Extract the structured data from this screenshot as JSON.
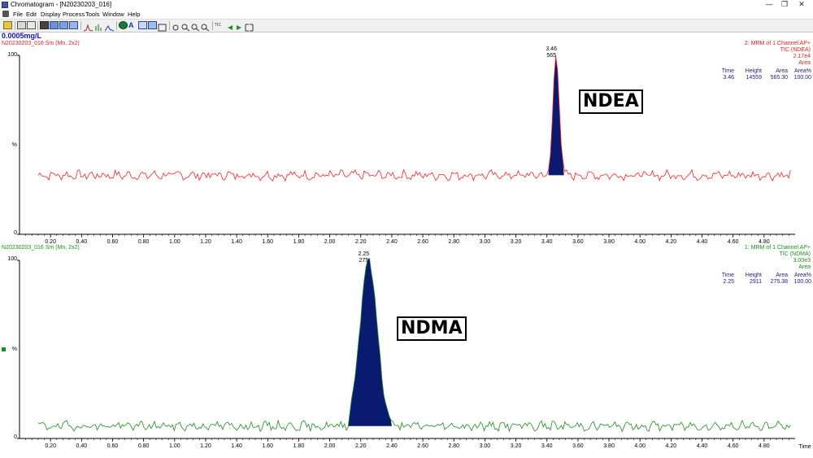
{
  "window": {
    "title": "Chromatogram - [N20230203_016]",
    "minimize_glyph": "—",
    "restore_glyph": "❐",
    "close_glyph": "✕"
  },
  "menu": [
    "File",
    "Edit",
    "Display",
    "Process",
    "Tools",
    "Window",
    "Help"
  ],
  "toolbar": {
    "icons": [
      "open-icon",
      "print-icon",
      "print-preview-icon",
      "copy-icon",
      "copy-list-icon",
      "paste-icon",
      "export-icon",
      "chromatogram-icon",
      "spectrum-icon",
      "combine-icon",
      "globe-icon",
      "text-icon",
      "list-icon",
      "peak-icon",
      "graph-icon",
      "pan-icon",
      "zoom-in-icon",
      "zoom-out-icon",
      "zoom-fit-icon",
      "restore-view-icon",
      "tic-icon",
      "previous-icon",
      "next-icon",
      "expand-icon"
    ],
    "tic_label": "TIC"
  },
  "concentration": "0.0005mg/L",
  "colors": {
    "trace_top": "#ff2020",
    "trace_bottom": "#1a8f1a",
    "peak_fill": "#0a1a70",
    "table_text": "#202080",
    "concentration": "#1010d0"
  },
  "traces": [
    {
      "id": "top",
      "sample_label": "N20230203_016 Sm (Mn, 2x2)",
      "info": [
        "2: MRM of 1 Channel AP+",
        "TIC (NDEA)",
        "2.17e4",
        "Area"
      ],
      "table_headers": [
        "Time",
        "Height",
        "Area",
        "Area%"
      ],
      "table_row": [
        "3.46",
        "14559",
        "565.30",
        "100.00"
      ],
      "peak_time_label": "3.46",
      "peak_area_label": "565",
      "compound": "NDEA",
      "y_top_label": "100",
      "y_mid_label": "%",
      "y_bottom_label": "0"
    },
    {
      "id": "bottom",
      "sample_label": "N20230203_016 Sm (Mn, 2x2)",
      "info": [
        "1: MRM of 1 Channel AP+",
        "TIC (NDMA)",
        "3.00e3",
        "Area"
      ],
      "table_headers": [
        "Time",
        "Height",
        "Area",
        "Area%"
      ],
      "table_row": [
        "2.25",
        "2911",
        "275.38",
        "100.00"
      ],
      "peak_time_label": "2.25",
      "peak_area_label": "275",
      "compound": "NDMA",
      "y_top_label": "100",
      "y_mid_label": "%",
      "y_bottom_label": "0"
    }
  ],
  "chart_data": [
    {
      "type": "line",
      "title": "TIC (NDEA)",
      "series": [
        {
          "name": "TIC (NDEA)"
        }
      ],
      "x_range": [
        0.0,
        5.0
      ],
      "y_range": [
        0,
        100
      ],
      "x_ticks": [
        "0.20",
        "0.40",
        "0.60",
        "0.80",
        "1.00",
        "1.20",
        "1.40",
        "1.60",
        "1.80",
        "2.00",
        "2.20",
        "2.40",
        "2.60",
        "2.80",
        "3.00",
        "3.20",
        "3.40",
        "3.60",
        "3.80",
        "4.00",
        "4.20",
        "4.40",
        "4.60",
        "4.80"
      ],
      "baseline_level": 33,
      "peak": {
        "time": 3.46,
        "height_pct": 100,
        "area": 565.3,
        "start": 3.41,
        "end": 3.51
      },
      "line_color": "#ff2020",
      "grid": false
    },
    {
      "type": "line",
      "title": "TIC (NDMA)",
      "series": [
        {
          "name": "TIC (NDMA)"
        }
      ],
      "x_range": [
        0.0,
        5.0
      ],
      "y_range": [
        0,
        100
      ],
      "x_ticks": [
        "0.20",
        "0.40",
        "0.60",
        "0.80",
        "1.00",
        "1.20",
        "1.40",
        "1.60",
        "1.80",
        "2.00",
        "2.20",
        "2.40",
        "2.60",
        "2.80",
        "3.00",
        "3.20",
        "3.40",
        "3.60",
        "3.80",
        "4.00",
        "4.20",
        "4.40",
        "4.60",
        "4.80"
      ],
      "x_axis_label": "Time",
      "baseline_level": 7,
      "peak": {
        "time": 2.25,
        "height_pct": 100,
        "area": 275.38,
        "start": 2.12,
        "end": 2.4
      },
      "line_color": "#1a8f1a",
      "grid": false
    }
  ]
}
